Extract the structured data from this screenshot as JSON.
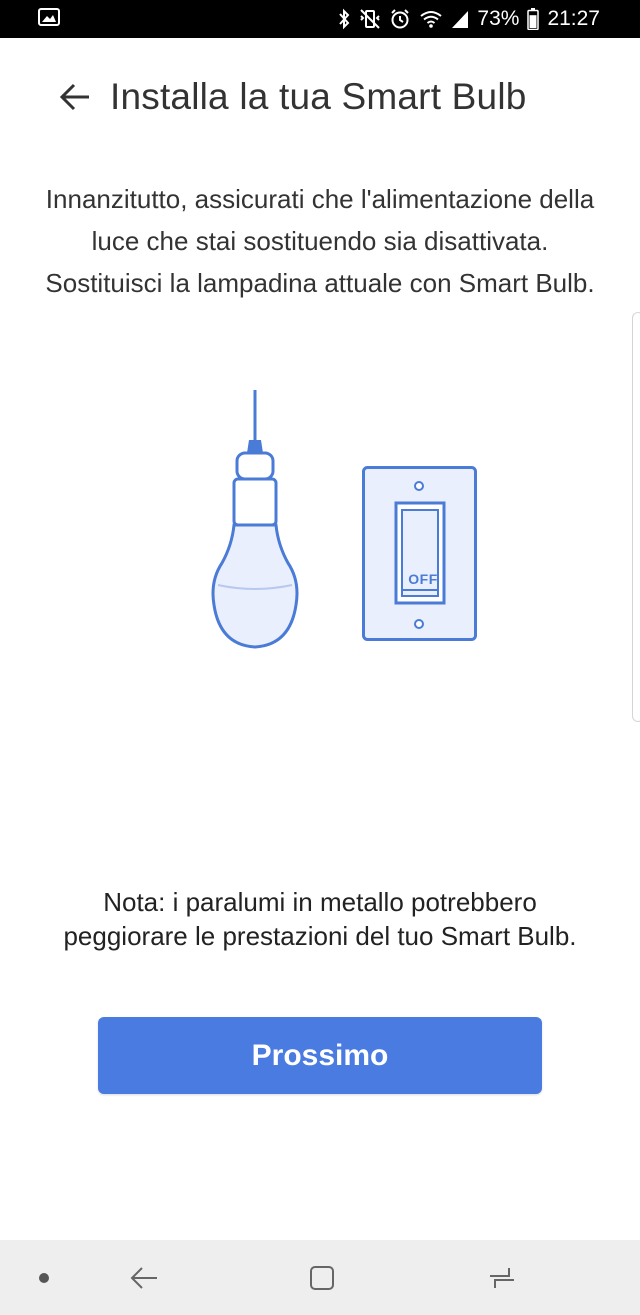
{
  "status_bar": {
    "left_icon": "gallery-notification-icon",
    "icons": [
      "bluetooth-icon",
      "vibrate-off-icon",
      "alarm-icon",
      "wifi-icon",
      "signal-icon"
    ],
    "battery_percent": "73%",
    "battery_level": 0.73,
    "time": "21:27"
  },
  "header": {
    "back_icon": "arrow-left-icon",
    "title": "Installa la tua Smart Bulb"
  },
  "instruction": {
    "text": "Innanzitutto, assicurati che l'alimentazione della luce che stai sostituendo sia disattivata. Sostituisci la lampadina attuale con Smart Bulb."
  },
  "illustration": {
    "bulb_icon": "light-bulb-icon",
    "switch_icon": "wall-switch-icon",
    "switch_label": "OFF"
  },
  "note": {
    "text": "Nota: i paralumi in metallo potrebbero peggiorare le prestazioni del tuo Smart Bulb."
  },
  "primary_button": {
    "label": "Prossimo"
  },
  "nav_bar": {
    "items": [
      "dot-icon",
      "back-icon",
      "home-icon",
      "recents-icon"
    ]
  },
  "colors": {
    "accent": "#4a7be0",
    "illustration_stroke": "#4a7bd6",
    "illustration_fill": "#e9effc",
    "status_bar": "#000000",
    "nav_bar": "#eeeeee"
  }
}
